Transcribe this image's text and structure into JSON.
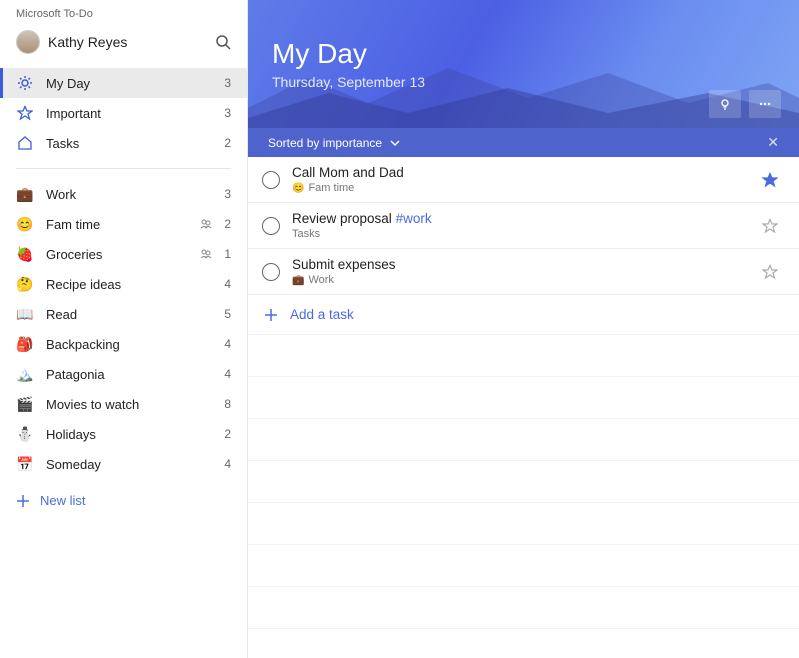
{
  "app_title": "Microsoft To-Do",
  "user": {
    "name": "Kathy Reyes"
  },
  "sidebar": {
    "smart_lists": [
      {
        "icon": "sun",
        "label": "My Day",
        "count": 3,
        "active": true,
        "color": "#3b5dd9"
      },
      {
        "icon": "star",
        "label": "Important",
        "count": 3,
        "active": false,
        "color": "#3b5dd9"
      },
      {
        "icon": "home",
        "label": "Tasks",
        "count": 2,
        "active": false,
        "color": "#3b5dd9"
      }
    ],
    "lists": [
      {
        "emoji": "💼",
        "label": "Work",
        "count": 3,
        "shared": false
      },
      {
        "emoji": "😊",
        "label": "Fam time",
        "count": 2,
        "shared": true
      },
      {
        "emoji": "🍓",
        "label": "Groceries",
        "count": 1,
        "shared": true
      },
      {
        "emoji": "🤔",
        "label": "Recipe ideas",
        "count": 4,
        "shared": false
      },
      {
        "emoji": "📖",
        "label": "Read",
        "count": 5,
        "shared": false
      },
      {
        "emoji": "🎒",
        "label": "Backpacking",
        "count": 4,
        "shared": false
      },
      {
        "emoji": "🏔️",
        "label": "Patagonia",
        "count": 4,
        "shared": false
      },
      {
        "emoji": "🎬",
        "label": "Movies to watch",
        "count": 8,
        "shared": false
      },
      {
        "emoji": "⛄",
        "label": "Holidays",
        "count": 2,
        "shared": false
      },
      {
        "emoji": "📅",
        "label": "Someday",
        "count": 4,
        "shared": false
      }
    ],
    "new_list_label": "New list"
  },
  "header": {
    "title": "My Day",
    "date": "Thursday, September 13"
  },
  "sortbar": {
    "text": "Sorted by importance"
  },
  "tasks": [
    {
      "title": "Call Mom and Dad",
      "tag": "",
      "list_emoji": "😊",
      "list_name": "Fam time",
      "starred": true
    },
    {
      "title": "Review proposal",
      "tag": "#work",
      "list_emoji": "",
      "list_name": "Tasks",
      "starred": false
    },
    {
      "title": "Submit expenses",
      "tag": "",
      "list_emoji": "💼",
      "list_name": "Work",
      "starred": false
    }
  ],
  "add_task_label": "Add a task"
}
